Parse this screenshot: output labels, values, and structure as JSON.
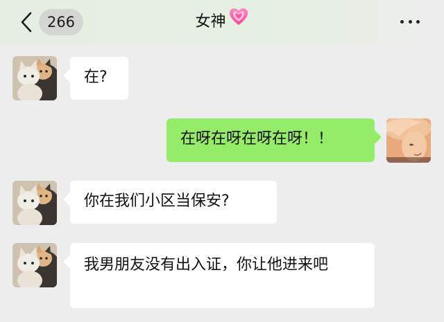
{
  "header": {
    "back_icon": "chevron-left-icon",
    "unread_count": "266",
    "title": "女神",
    "title_emoji": "pink-heart-icon",
    "more_icon": "more-dots-icon"
  },
  "messages": [
    {
      "side": "left",
      "avatar": "cats-avatar",
      "text": "在?"
    },
    {
      "side": "right",
      "avatar": "portrait-avatar",
      "text": "在呀在呀在呀在呀！！"
    },
    {
      "side": "left",
      "avatar": "cats-avatar",
      "text": "你在我们小区当保安?"
    },
    {
      "side": "left",
      "avatar": "cats-avatar",
      "text": "我男朋友没有出入证，你让他进来吧"
    }
  ],
  "colors": {
    "background": "#ededed",
    "sent_bubble": "#95ec69",
    "received_bubble": "#ffffff",
    "heart": "#ff5aa5"
  }
}
